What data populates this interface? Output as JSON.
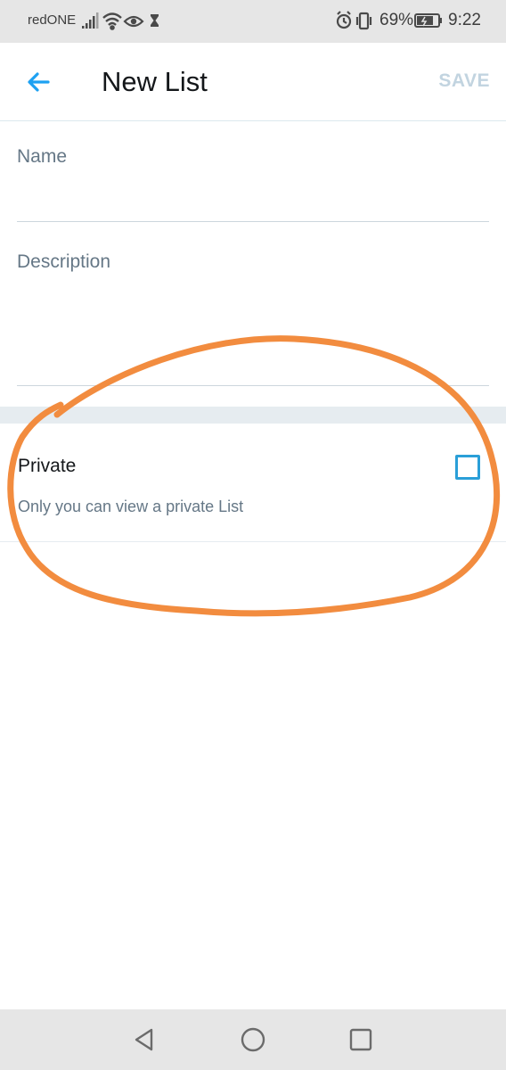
{
  "status_bar": {
    "carrier": "redONE",
    "battery_percent": "69%",
    "time": "9:22",
    "icons": [
      "signal-icon",
      "wifi-icon",
      "eye-icon",
      "hourglass-icon",
      "alarm-icon",
      "vibrate-icon",
      "battery-icon"
    ]
  },
  "header": {
    "title": "New List",
    "save_label": "SAVE",
    "back_icon": "back-arrow-icon"
  },
  "form": {
    "name_label": "Name",
    "description_label": "Description"
  },
  "private": {
    "title": "Private",
    "subtitle": "Only you can view a private List",
    "checked": false
  },
  "nav_bar": {
    "icons": [
      "back-triangle-icon",
      "home-circle-icon",
      "recents-square-icon"
    ]
  },
  "colors": {
    "accent": "#1da1f2",
    "annotation": "#f28c3f",
    "text_primary": "#14171a",
    "text_secondary": "#657786",
    "save_disabled": "#c2d4e0"
  }
}
